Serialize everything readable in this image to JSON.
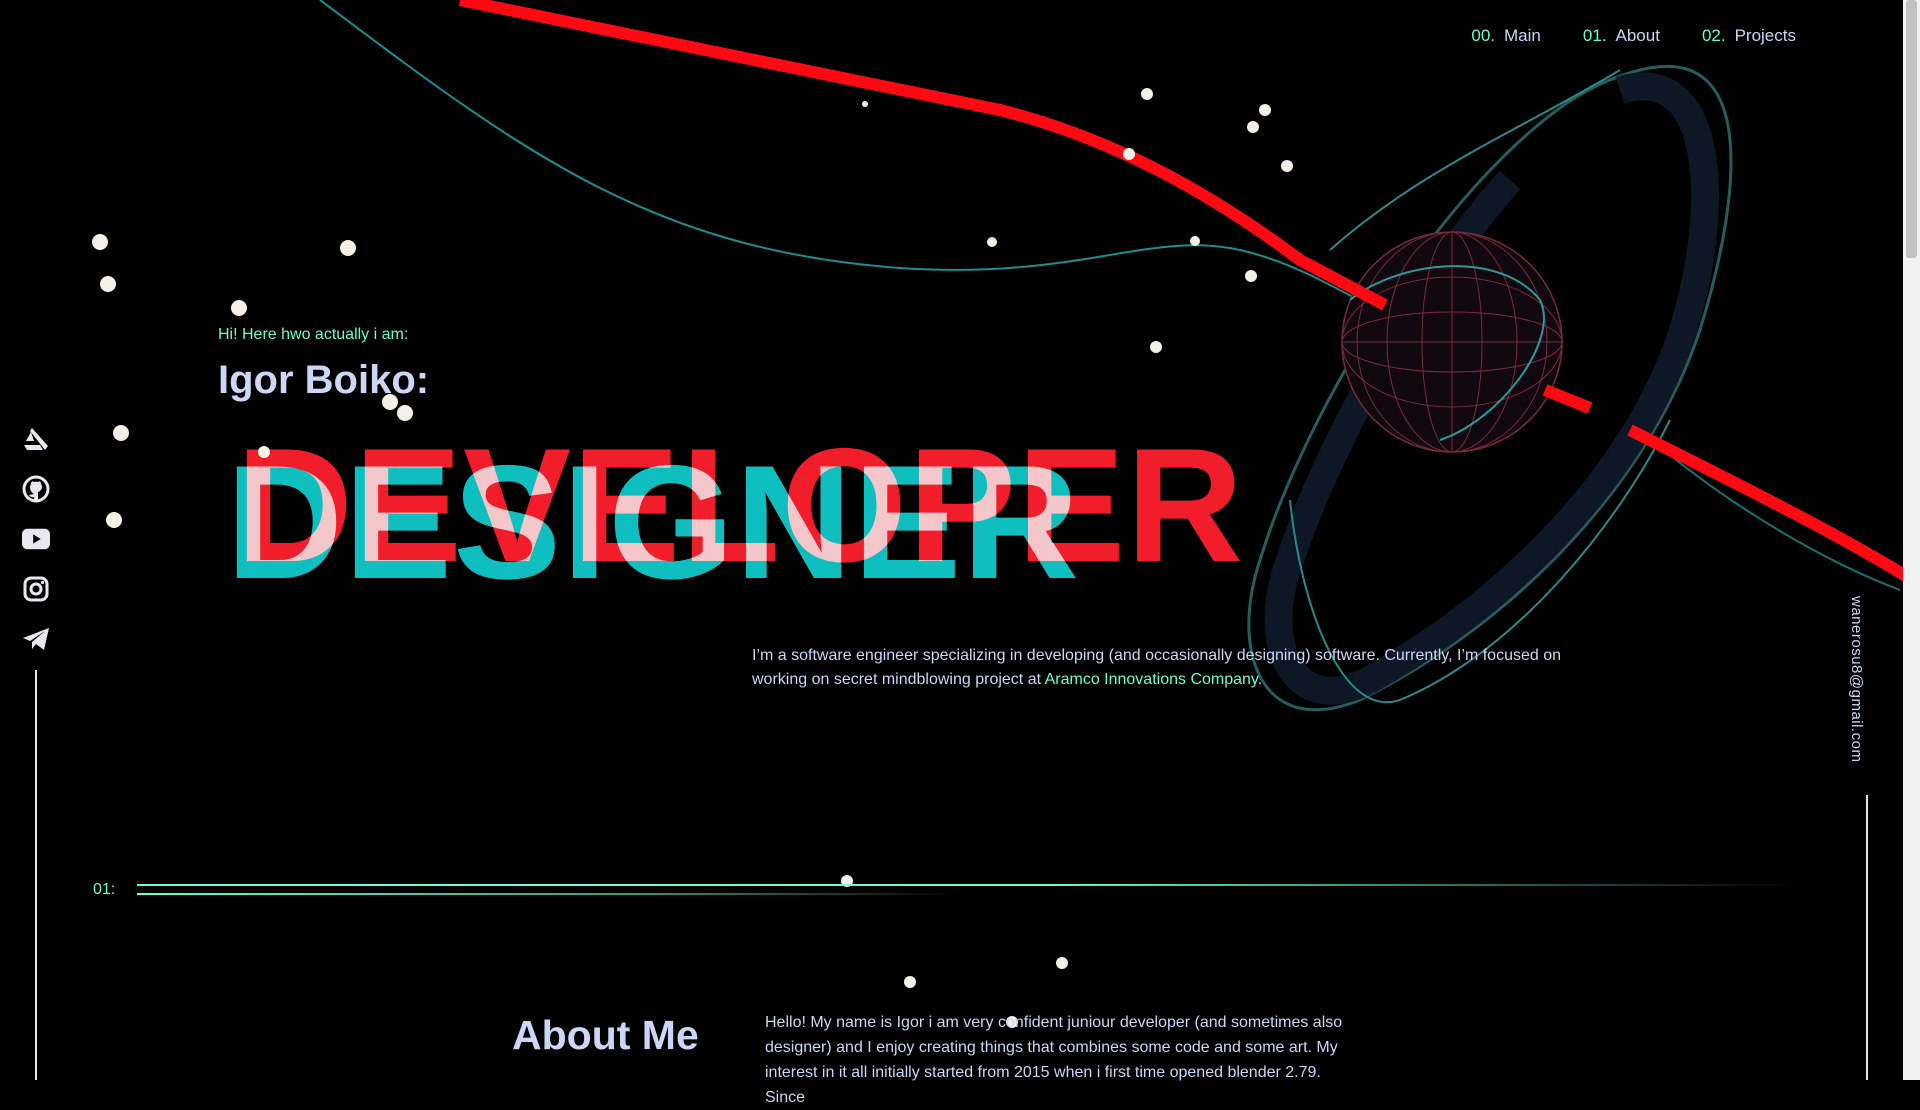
{
  "nav": {
    "items": [
      {
        "num": "00.",
        "label": "Main"
      },
      {
        "num": "01.",
        "label": "About"
      },
      {
        "num": "02.",
        "label": "Projects"
      }
    ]
  },
  "socials": [
    {
      "icon": "artstation-icon"
    },
    {
      "icon": "github-icon"
    },
    {
      "icon": "youtube-icon"
    },
    {
      "icon": "instagram-icon"
    },
    {
      "icon": "telegram-icon"
    }
  ],
  "hero": {
    "greeting": "Hi! Here hwo actually i am:",
    "name": "Igor Boiko:",
    "word_front": "DEVELOPER",
    "word_back": "DESIGNER",
    "intro_text": "I’m a software engineer specializing in developing (and occasionally designing) software. Currently, I’m focused on working on secret mindblowing project at ",
    "intro_link": "Aramco Innovations Company",
    "intro_end": "."
  },
  "email": "wanerosu8@gmail.com",
  "section": {
    "num": "01:",
    "title": "About Me",
    "text": "Hello! My name is Igor i am very confident juniour developer (and sometimes also designer) and I enjoy creating things that combines some code and some art. My interest in it all initially started from 2015 when i first time opened blender 2.79. Since"
  },
  "colors": {
    "accent": "#64ffda",
    "text": "#ccd6f6",
    "red": "#ff1e2d",
    "cyan": "#0fbfbf",
    "background": "#000000"
  }
}
